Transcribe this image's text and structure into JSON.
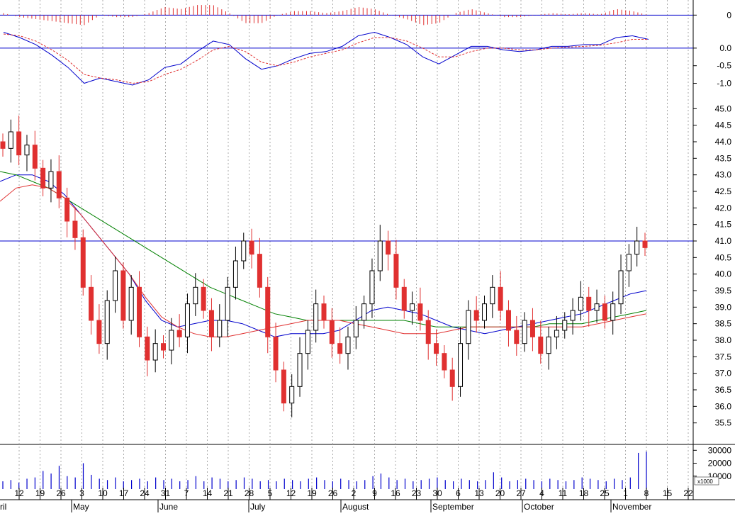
{
  "chart_data": [
    {
      "panel": "histogram",
      "type": "bar",
      "y_ticks": [
        {
          "value": 0,
          "label": "0"
        }
      ],
      "ylim": [
        -0.5,
        0.45
      ],
      "colors": {
        "positive": "#e03030",
        "negative": "#e03030",
        "zero_line": "#0000cc"
      }
    },
    {
      "panel": "oscillator",
      "type": "line",
      "y_ticks": [
        {
          "value": 0.0,
          "label": "0.0"
        },
        {
          "value": -0.5,
          "label": "-0.5"
        },
        {
          "value": -1.0,
          "label": "-1.0"
        }
      ],
      "ylim": [
        -1.15,
        0.4
      ],
      "series": [
        {
          "color": "#0000cc",
          "style": "solid",
          "values": [
            0.45,
            0.3,
            0.1,
            -0.2,
            -0.55,
            -1.0,
            -0.85,
            -0.95,
            -1.05,
            -0.9,
            -0.55,
            -0.45,
            -0.1,
            0.2,
            0.1,
            -0.3,
            -0.6,
            -0.5,
            -0.3,
            -0.15,
            -0.1,
            0.05,
            0.35,
            0.45,
            0.3,
            0.1,
            -0.25,
            -0.45,
            -0.2,
            0.05,
            0.05,
            -0.05,
            -0.1,
            -0.05,
            0.05,
            0.05,
            0.1,
            0.1,
            0.3,
            0.35,
            0.25
          ]
        },
        {
          "color": "#e03030",
          "style": "dashed",
          "values": [
            0.4,
            0.35,
            0.2,
            -0.05,
            -0.35,
            -0.75,
            -0.85,
            -0.9,
            -1.0,
            -0.95,
            -0.75,
            -0.6,
            -0.35,
            -0.05,
            0.05,
            -0.1,
            -0.4,
            -0.5,
            -0.4,
            -0.25,
            -0.15,
            -0.05,
            0.15,
            0.3,
            0.3,
            0.2,
            0.0,
            -0.25,
            -0.25,
            -0.1,
            0.0,
            0.0,
            -0.05,
            -0.05,
            0.0,
            0.03,
            0.05,
            0.08,
            0.15,
            0.25,
            0.25
          ]
        }
      ]
    },
    {
      "panel": "price",
      "type": "candlestick",
      "ylim": [
        35.0,
        45.5
      ],
      "y_ticks": [
        {
          "value": 45.0,
          "label": "45.0"
        },
        {
          "value": 44.5,
          "label": "44.5"
        },
        {
          "value": 44.0,
          "label": "44.0"
        },
        {
          "value": 43.5,
          "label": "43.5"
        },
        {
          "value": 43.0,
          "label": "43.0"
        },
        {
          "value": 42.5,
          "label": "42.5"
        },
        {
          "value": 42.0,
          "label": "42.0"
        },
        {
          "value": 41.5,
          "label": "41.5"
        },
        {
          "value": 41.0,
          "label": "41.0"
        },
        {
          "value": 40.5,
          "label": "40.5"
        },
        {
          "value": 40.0,
          "label": "40.0"
        },
        {
          "value": 39.5,
          "label": "39.5"
        },
        {
          "value": 39.0,
          "label": "39.0"
        },
        {
          "value": 38.5,
          "label": "38.5"
        },
        {
          "value": 38.0,
          "label": "38.0"
        },
        {
          "value": 37.5,
          "label": "37.5"
        },
        {
          "value": 37.0,
          "label": "37.0"
        },
        {
          "value": 36.5,
          "label": "36.5"
        },
        {
          "value": 36.0,
          "label": "36.0"
        },
        {
          "value": 35.5,
          "label": "35.5"
        }
      ],
      "horizontal_line": 41.0,
      "closes": [
        43.8,
        44.3,
        43.6,
        43.9,
        43.2,
        42.6,
        43.1,
        42.3,
        41.6,
        41.1,
        39.6,
        38.6,
        37.9,
        39.2,
        40.1,
        38.6,
        39.6,
        38.1,
        37.4,
        37.9,
        37.7,
        38.3,
        38.1,
        39.1,
        39.6,
        38.9,
        38.1,
        38.6,
        39.6,
        40.4,
        41.0,
        40.6,
        39.6,
        38.1,
        37.1,
        36.1,
        36.6,
        37.6,
        38.3,
        39.1,
        38.6,
        37.9,
        37.6,
        38.1,
        38.6,
        39.1,
        40.1,
        41.0,
        40.6,
        39.6,
        38.9,
        39.1,
        38.6,
        37.9,
        37.6,
        37.1,
        36.6,
        37.9,
        38.9,
        38.6,
        39.1,
        39.6,
        38.9,
        38.3,
        37.9,
        38.6,
        38.1,
        37.6,
        38.1,
        38.3,
        38.6,
        38.9,
        39.3,
        38.9,
        39.1,
        38.6,
        39.1,
        40.1,
        40.6,
        41.0,
        40.8
      ],
      "series": [
        {
          "color": "#0000cc",
          "values": [
            42.8,
            43.0,
            43.0,
            42.8,
            42.4,
            41.8,
            41.2,
            40.6,
            40.0,
            39.2,
            38.6,
            38.4,
            38.5,
            38.6,
            38.6,
            38.5,
            38.3,
            38.1,
            38.2,
            38.2,
            38.2,
            38.3,
            38.6,
            38.9,
            39.0,
            38.9,
            38.8,
            38.6,
            38.4,
            38.3,
            38.2,
            38.3,
            38.4,
            38.5,
            38.6,
            38.7,
            38.8,
            39.0,
            39.2,
            39.4,
            39.5
          ]
        },
        {
          "color": "#008000",
          "values": [
            43.1,
            43.0,
            42.8,
            42.6,
            42.3,
            42.0,
            41.7,
            41.4,
            41.1,
            40.8,
            40.5,
            40.2,
            39.9,
            39.6,
            39.4,
            39.2,
            39.0,
            38.8,
            38.7,
            38.6,
            38.6,
            38.6,
            38.6,
            38.6,
            38.6,
            38.6,
            38.5,
            38.4,
            38.4,
            38.4,
            38.4,
            38.4,
            38.4,
            38.4,
            38.5,
            38.5,
            38.5,
            38.6,
            38.7,
            38.8,
            38.9
          ]
        },
        {
          "color": "#e03030",
          "values": [
            42.2,
            42.6,
            42.7,
            42.6,
            42.3,
            41.8,
            41.2,
            40.6,
            40.0,
            39.3,
            38.7,
            38.4,
            38.2,
            38.1,
            38.1,
            38.2,
            38.3,
            38.4,
            38.5,
            38.6,
            38.6,
            38.6,
            38.5,
            38.4,
            38.3,
            38.2,
            38.2,
            38.2,
            38.3,
            38.4,
            38.4,
            38.4,
            38.4,
            38.4,
            38.4,
            38.4,
            38.4,
            38.5,
            38.6,
            38.7,
            38.8
          ]
        }
      ]
    },
    {
      "panel": "volume",
      "type": "bar",
      "ylim": [
        0,
        34000
      ],
      "y_ticks": [
        {
          "value": 30000,
          "label": "30000"
        },
        {
          "value": 20000,
          "label": "20000"
        },
        {
          "value": 10000,
          "label": "10000"
        }
      ],
      "unit_label": "x1000",
      "values": [
        6000,
        7000,
        5000,
        8000,
        9000,
        14000,
        12000,
        18000,
        10000,
        9000,
        20000,
        11000,
        8000,
        7000,
        9000,
        6000,
        7000,
        8000,
        6000,
        9000,
        7000,
        8000,
        6000,
        7000,
        10000,
        6000,
        9000,
        8000,
        6000,
        7000,
        9000,
        8000,
        6000,
        7000,
        6000,
        8000,
        7000,
        6000,
        8000,
        9000,
        7000,
        6000,
        8000,
        7000,
        6000,
        7000,
        10000,
        12000,
        9000,
        7000,
        8000,
        6000,
        7000,
        8000,
        9000,
        7000,
        6000,
        8000,
        7000,
        6000,
        7000,
        13000,
        9000,
        6000,
        7000,
        8000,
        7000,
        6000,
        8000,
        7000,
        6000,
        7000,
        9000,
        8000,
        7000,
        6000,
        8000,
        7000,
        9000,
        28000,
        29000
      ]
    }
  ],
  "x_axis": {
    "day_labels": [
      "12",
      "19",
      "26",
      "3",
      "10",
      "17",
      "24",
      "31",
      "7",
      "14",
      "21",
      "28",
      "5",
      "12",
      "19",
      "26",
      "2",
      "9",
      "16",
      "23",
      "30",
      "6",
      "13",
      "20",
      "27",
      "4",
      "11",
      "18",
      "25",
      "1",
      "8",
      "15",
      "22"
    ],
    "month_labels": [
      "May",
      "June",
      "July",
      "August",
      "September",
      "October",
      "November"
    ],
    "partial_month_label": "ril"
  }
}
